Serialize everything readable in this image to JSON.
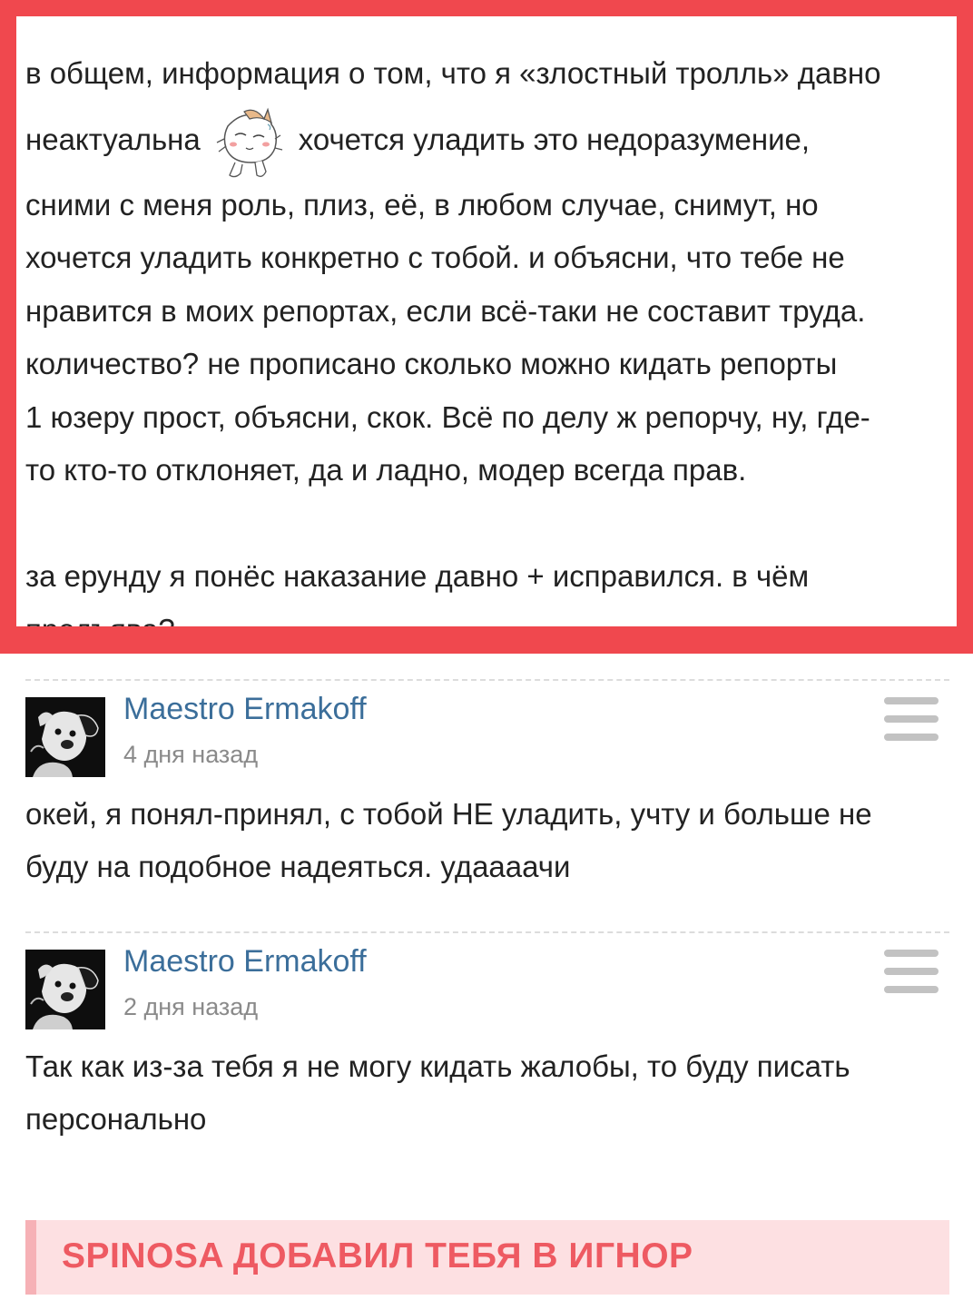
{
  "highlighted_message": {
    "lines": [
      "в общем, информация о том, что я «злостный тролль» давно",
      "неактуальна",
      "хочется уладить это недоразумение,",
      "сними с меня роль, плиз, её, в любом случае, снимут, но",
      "хочется уладить конкретно с тобой. и объясни, что тебе не",
      "нравится в моих репортах, если всё-таки не составит труда.",
      "количество? не прописано сколько можно кидать репорты",
      "1 юзеру прост, объясни, скок. Всё по делу ж репорчу, ну, где-",
      "то кто-то отклоняет, да и ладно, модер всегда прав.",
      "за ерунду я понёс наказание давно + исправился. в чём",
      "предъява?"
    ],
    "emoji": "sweating-cat-sticker",
    "frame_color": "#f0484e"
  },
  "comments": [
    {
      "author": "Maestro Ermakoff",
      "time": "4 дня назад",
      "text_lines": [
        "окей, я понял-принял, с тобой НЕ уладить, учту и больше не",
        "буду на подобное надеяться. удаааачи"
      ]
    },
    {
      "author": "Maestro Ermakoff",
      "time": "2 дня назад",
      "text_lines": [
        "Так как из-за тебя я не могу кидать жалобы, то буду писать",
        "персонально"
      ]
    }
  ],
  "banner": {
    "text": "SPINOSA ДОБАВИЛ ТЕБЯ В ИГНОР",
    "color": "#ee5a62"
  },
  "colors": {
    "author_link": "#3b6e9a",
    "time": "#8a8a8a"
  }
}
